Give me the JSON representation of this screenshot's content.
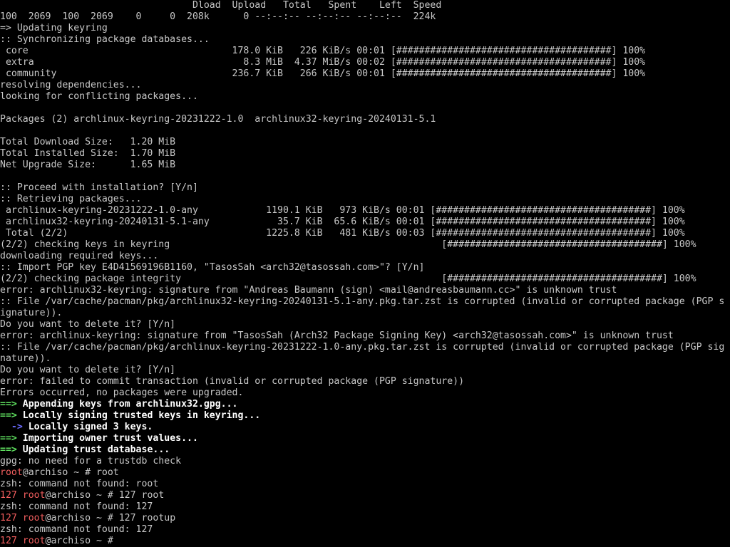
{
  "colors": {
    "background": "#000000",
    "text": "#c8c8c8",
    "bold_text": "#ffffff",
    "red": "#f25e5e",
    "green": "#5fe05f",
    "blue": "#6b6bff"
  },
  "lines": [
    {
      "segments": [
        {
          "text": "                                  Dload  Upload   Total   Spent    Left  Speed",
          "style": "norm"
        }
      ]
    },
    {
      "segments": [
        {
          "text": "100  2069  100  2069    0     0  208k      0 --:--:-- --:--:-- --:--:--  224k",
          "style": "norm"
        }
      ]
    },
    {
      "segments": [
        {
          "text": "=> Updating keyring",
          "style": "norm"
        }
      ]
    },
    {
      "segments": [
        {
          "text": ":: Synchronizing package databases...",
          "style": "norm"
        }
      ]
    },
    {
      "segments": [
        {
          "text": " core                                    178.0 KiB   226 KiB/s 00:01 [######################################] 100%",
          "style": "norm"
        }
      ]
    },
    {
      "segments": [
        {
          "text": " extra                                     8.3 MiB  4.37 MiB/s 00:02 [######################################] 100%",
          "style": "norm"
        }
      ]
    },
    {
      "segments": [
        {
          "text": " community                               236.7 KiB   266 KiB/s 00:01 [######################################] 100%",
          "style": "norm"
        }
      ]
    },
    {
      "segments": [
        {
          "text": "resolving dependencies...",
          "style": "norm"
        }
      ]
    },
    {
      "segments": [
        {
          "text": "looking for conflicting packages...",
          "style": "norm"
        }
      ]
    },
    {
      "segments": [
        {
          "text": "",
          "style": "norm"
        }
      ]
    },
    {
      "segments": [
        {
          "text": "Packages (2) archlinux-keyring-20231222-1.0  archlinux32-keyring-20240131-5.1",
          "style": "norm"
        }
      ]
    },
    {
      "segments": [
        {
          "text": "",
          "style": "norm"
        }
      ]
    },
    {
      "segments": [
        {
          "text": "Total Download Size:   1.20 MiB",
          "style": "norm"
        }
      ]
    },
    {
      "segments": [
        {
          "text": "Total Installed Size:  1.70 MiB",
          "style": "norm"
        }
      ]
    },
    {
      "segments": [
        {
          "text": "Net Upgrade Size:      1.65 MiB",
          "style": "norm"
        }
      ]
    },
    {
      "segments": [
        {
          "text": "",
          "style": "norm"
        }
      ]
    },
    {
      "segments": [
        {
          "text": ":: Proceed with installation? [Y/n]",
          "style": "norm"
        }
      ]
    },
    {
      "segments": [
        {
          "text": ":: Retrieving packages...",
          "style": "norm"
        }
      ]
    },
    {
      "segments": [
        {
          "text": " archlinux-keyring-20231222-1.0-any            1190.1 KiB   973 KiB/s 00:01 [######################################] 100%",
          "style": "norm"
        }
      ]
    },
    {
      "segments": [
        {
          "text": " archlinux32-keyring-20240131-5.1-any            35.7 KiB  65.6 KiB/s 00:01 [######################################] 100%",
          "style": "norm"
        }
      ]
    },
    {
      "segments": [
        {
          "text": " Total (2/2)                                   1225.8 KiB   481 KiB/s 00:03 [######################################] 100%",
          "style": "norm"
        }
      ]
    },
    {
      "segments": [
        {
          "text": "(2/2) checking keys in keyring                                                [######################################] 100%",
          "style": "norm"
        }
      ]
    },
    {
      "segments": [
        {
          "text": "downloading required keys...",
          "style": "norm"
        }
      ]
    },
    {
      "segments": [
        {
          "text": ":: Import PGP key E4D41569196B1160, \"TasosSah <arch32@tasossah.com>\"? [Y/n]",
          "style": "norm"
        }
      ]
    },
    {
      "segments": [
        {
          "text": "(2/2) checking package integrity                                              [######################################] 100%",
          "style": "norm"
        }
      ]
    },
    {
      "segments": [
        {
          "text": "error: archlinux32-keyring: signature from \"Andreas Baumann (sign) <mail@andreasbaumann.cc>\" is unknown trust",
          "style": "norm"
        }
      ]
    },
    {
      "segments": [
        {
          "text": ":: File /var/cache/pacman/pkg/archlinux32-keyring-20240131-5.1-any.pkg.tar.zst is corrupted (invalid or corrupted package (PGP s",
          "style": "norm"
        }
      ]
    },
    {
      "segments": [
        {
          "text": "ignature)).",
          "style": "norm"
        }
      ]
    },
    {
      "segments": [
        {
          "text": "Do you want to delete it? [Y/n]",
          "style": "norm"
        }
      ]
    },
    {
      "segments": [
        {
          "text": "error: archlinux-keyring: signature from \"TasosSah (Arch32 Package Signing Key) <arch32@tasossah.com>\" is unknown trust",
          "style": "norm"
        }
      ]
    },
    {
      "segments": [
        {
          "text": ":: File /var/cache/pacman/pkg/archlinux-keyring-20231222-1.0-any.pkg.tar.zst is corrupted (invalid or corrupted package (PGP sig",
          "style": "norm"
        }
      ]
    },
    {
      "segments": [
        {
          "text": "nature)).",
          "style": "norm"
        }
      ]
    },
    {
      "segments": [
        {
          "text": "Do you want to delete it? [Y/n]",
          "style": "norm"
        }
      ]
    },
    {
      "segments": [
        {
          "text": "error: failed to commit transaction (invalid or corrupted package (PGP signature))",
          "style": "norm"
        }
      ]
    },
    {
      "segments": [
        {
          "text": "Errors occurred, no packages were upgraded.",
          "style": "norm"
        }
      ]
    },
    {
      "segments": [
        {
          "text": "==>",
          "style": "green"
        },
        {
          "text": " Appending keys from archlinux32.gpg...",
          "style": "white"
        }
      ]
    },
    {
      "segments": [
        {
          "text": "==>",
          "style": "green"
        },
        {
          "text": " Locally signing trusted keys in keyring...",
          "style": "white"
        }
      ]
    },
    {
      "segments": [
        {
          "text": "  ->",
          "style": "blue"
        },
        {
          "text": " Locally signed 3 keys.",
          "style": "white"
        }
      ]
    },
    {
      "segments": [
        {
          "text": "==>",
          "style": "green"
        },
        {
          "text": " Importing owner trust values...",
          "style": "white"
        }
      ]
    },
    {
      "segments": [
        {
          "text": "==>",
          "style": "green"
        },
        {
          "text": " Updating trust database...",
          "style": "white"
        }
      ]
    },
    {
      "segments": [
        {
          "text": "gpg: no need for a trustdb check",
          "style": "norm"
        }
      ]
    },
    {
      "segments": [
        {
          "text": "root",
          "style": "red"
        },
        {
          "text": "@archiso ~ # root",
          "style": "norm"
        }
      ]
    },
    {
      "segments": [
        {
          "text": "zsh: command not found: root",
          "style": "norm"
        }
      ]
    },
    {
      "segments": [
        {
          "text": "127 root",
          "style": "red"
        },
        {
          "text": "@archiso ~ # 127 root",
          "style": "norm"
        }
      ]
    },
    {
      "segments": [
        {
          "text": "zsh: command not found: 127",
          "style": "norm"
        }
      ]
    },
    {
      "segments": [
        {
          "text": "127 root",
          "style": "red"
        },
        {
          "text": "@archiso ~ # 127 rootup",
          "style": "norm"
        }
      ]
    },
    {
      "segments": [
        {
          "text": "zsh: command not found: 127",
          "style": "norm"
        }
      ]
    },
    {
      "segments": [
        {
          "text": "127 root",
          "style": "red"
        },
        {
          "text": "@archiso ~ # ",
          "style": "norm"
        },
        {
          "text": "                                                                                                                          :(",
          "style": "norm"
        }
      ]
    }
  ]
}
